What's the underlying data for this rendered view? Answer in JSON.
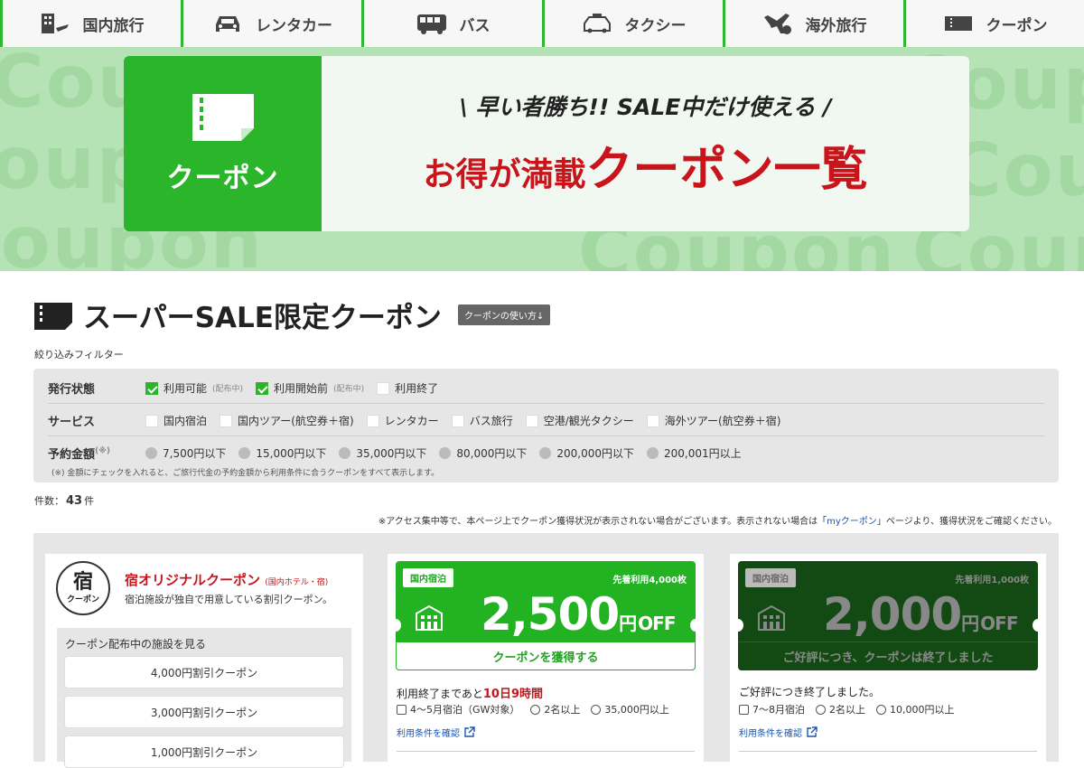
{
  "nav": {
    "items": [
      {
        "label": "国内旅行",
        "icon": "hotel-icon"
      },
      {
        "label": "レンタカー",
        "icon": "car-icon"
      },
      {
        "label": "バス",
        "icon": "bus-icon"
      },
      {
        "label": "タクシー",
        "icon": "taxi-icon"
      },
      {
        "label": "海外旅行",
        "icon": "airplane-icon"
      },
      {
        "label": "クーポン",
        "icon": "coupon-icon"
      }
    ]
  },
  "hero": {
    "left_label": "クーポン",
    "sub": "\\ 早い者勝ち!! SALE中だけ使える /",
    "main_small": "お得が満載",
    "main_big": "クーポン一覧",
    "bg_word": "Coupon"
  },
  "page": {
    "title": "スーパーSALE限定クーポン",
    "howto": "クーポンの使い方↓",
    "filter_label": "絞り込みフィルター"
  },
  "filters": {
    "status": {
      "name": "発行状態",
      "options": [
        {
          "label": "利用可能",
          "note": "(配布中)",
          "checked": true
        },
        {
          "label": "利用開始前",
          "note": "(配布中)",
          "checked": true
        },
        {
          "label": "利用終了",
          "note": "",
          "checked": false
        }
      ]
    },
    "service": {
      "name": "サービス",
      "options": [
        "国内宿泊",
        "国内ツアー(航空券＋宿)",
        "レンタカー",
        "バス旅行",
        "空港/観光タクシー",
        "海外ツアー(航空券＋宿)"
      ]
    },
    "price": {
      "name": "予約金額",
      "mark": "(※)",
      "options": [
        "7,500円以下",
        "15,000円以下",
        "35,000円以下",
        "80,000円以下",
        "200,000円以下",
        "200,001円以上"
      ]
    },
    "note": "(※) 金額にチェックを入れると、ご旅行代金の予約金額から利用条件に合うクーポンをすべて表示します。"
  },
  "count": {
    "label": "件数：",
    "value": "43",
    "unit": "件"
  },
  "notice": {
    "before": "※アクセス集中等で、本ページ上でクーポン獲得状況が表示されない場合がございます。表示されない場合は「",
    "link": "myクーポン",
    "after": "」ページより、獲得状況をご確認ください。"
  },
  "yado_card": {
    "logo_kanji": "宿",
    "logo_sub": "クーポン",
    "title": "宿オリジナルクーポン",
    "title_sub": "(国内ホテル・宿)",
    "desc": "宿泊施設が独自で用意している割引クーポン。",
    "facility_label": "クーポン配布中の施設を見る",
    "buttons": [
      "4,000円割引クーポン",
      "3,000円割引クーポン",
      "1,000円割引クーポン"
    ]
  },
  "coupon1": {
    "badge": "国内宿泊",
    "limit": "先着利用4,000枚",
    "amount": "2,500",
    "unit": "円",
    "off": "OFF",
    "action": "クーポンを獲得する",
    "status_prefix": "利用終了まであと",
    "status_highlight": "10日9時間",
    "period": "4〜5月宿泊（GW対象）",
    "people": "2名以上",
    "min": "35,000円以上",
    "link": "利用条件を確認"
  },
  "coupon2": {
    "badge": "国内宿泊",
    "limit": "先着利用1,000枚",
    "amount": "2,000",
    "unit": "円",
    "off": "OFF",
    "action": "ご好評につき、クーポンは終了しました",
    "status": "ご好評につき終了しました。",
    "period": "7〜8月宿泊",
    "people": "2名以上",
    "min": "10,000円以上",
    "link": "利用条件を確認"
  }
}
